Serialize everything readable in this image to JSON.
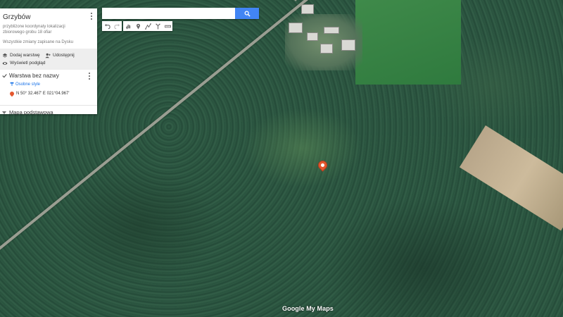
{
  "panel": {
    "map_title": "Grzybów",
    "map_description": "przybliżone koordynaty lokalizacji zbiorowego grobu 18 ofiar",
    "save_status": "Wszystkie zmiany zapisane na Dysku",
    "actions": {
      "add_layer": "Dodaj warstwę",
      "share": "Udostępnij",
      "preview": "Wyświetl podgląd"
    },
    "layer": {
      "name": "Warstwa bez nazwy",
      "style_link": "Osobne style",
      "point_label": "N 50° 32.467' E 021°04.967'"
    },
    "base_map": "Mapa podstawowa"
  },
  "search": {
    "value": "",
    "placeholder": ""
  },
  "toolbar": {
    "icons": [
      "undo-icon",
      "redo-icon",
      "hand-icon",
      "marker-icon",
      "line-icon",
      "directions-icon",
      "ruler-icon"
    ]
  },
  "branding": {
    "logo": "Google My Maps"
  },
  "colors": {
    "accent": "#4285f4",
    "pin": "#e4572e",
    "link": "#1a73e8"
  }
}
